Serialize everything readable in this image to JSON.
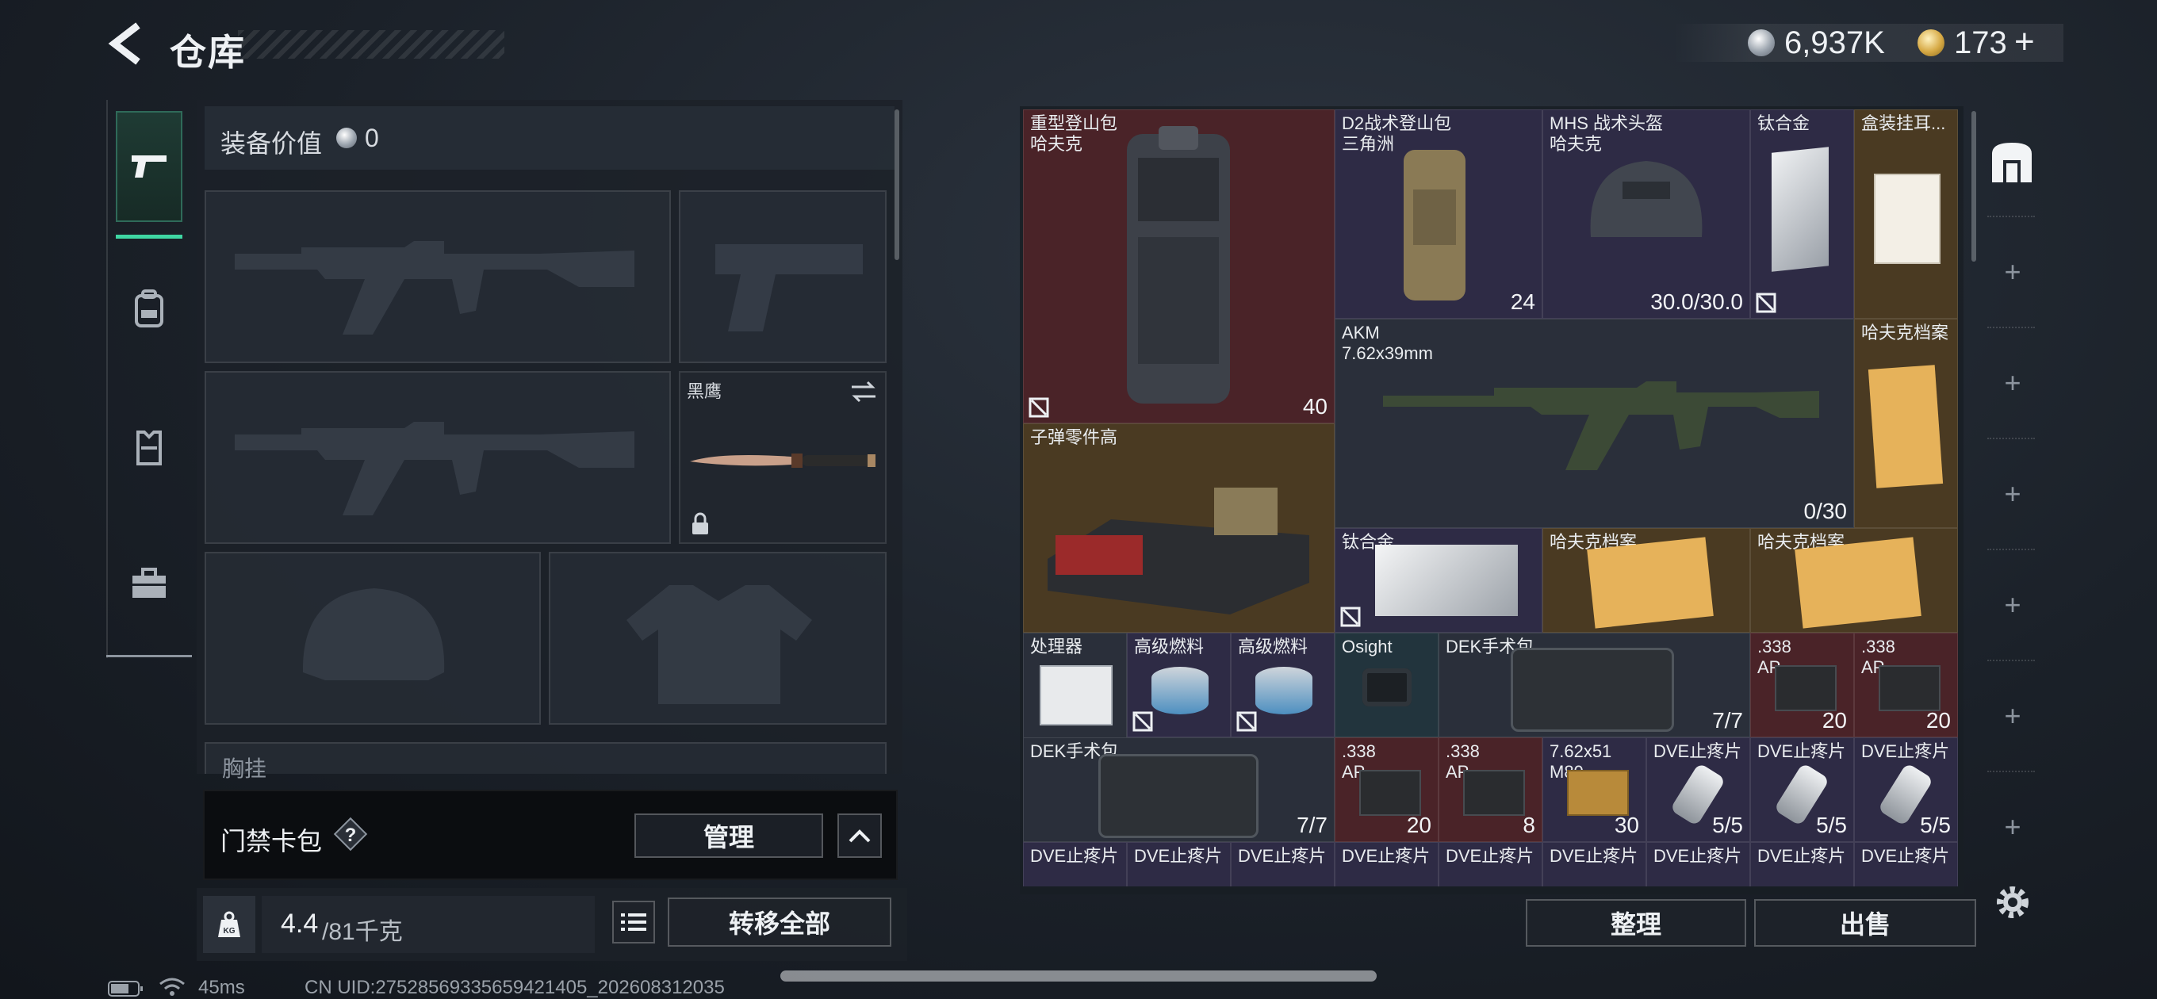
{
  "header": {
    "title": "仓库",
    "currency_silver": "6,937K",
    "currency_gold": "173",
    "add_label": "+"
  },
  "equipment": {
    "label": "装备价值",
    "value": "0",
    "slot_knife_name": "黑鹰",
    "section_chest": "胸挂",
    "keycase_label": "门禁卡包",
    "manage_label": "管理",
    "weight_value": "4.4",
    "weight_max": "/81千克",
    "transfer_all_label": "转移全部"
  },
  "stash": {
    "items": [
      {
        "name": "重型登山包\n哈夫克",
        "count": "40"
      },
      {
        "name": "D2战术登山包\n三角洲",
        "count": "24"
      },
      {
        "name": "MHS 战术头盔\n哈夫克",
        "count": "30.0/30.0"
      },
      {
        "name": "钛合金",
        "count": ""
      },
      {
        "name": "盒装挂耳...",
        "count": ""
      },
      {
        "name": "AKM\n7.62x39mm",
        "count": "0/30"
      },
      {
        "name": "哈夫克档案",
        "count": ""
      },
      {
        "name": "子弹零件高",
        "count": ""
      },
      {
        "name": "钛合金",
        "count": ""
      },
      {
        "name": "哈夫克档案",
        "count": ""
      },
      {
        "name": "哈夫克档案",
        "count": ""
      },
      {
        "name": "处理器",
        "count": ""
      },
      {
        "name": "高级燃料",
        "count": ""
      },
      {
        "name": "高级燃料",
        "count": ""
      },
      {
        "name": "Osight",
        "count": ""
      },
      {
        "name": "DEK手术包",
        "count": "7/7"
      },
      {
        "name": ".338\nAP",
        "count": "20"
      },
      {
        "name": ".338\nAP",
        "count": "20"
      },
      {
        "name": "DEK手术包",
        "count": "7/7"
      },
      {
        "name": ".338\nAP",
        "count": "20"
      },
      {
        "name": ".338\nAP",
        "count": "8"
      },
      {
        "name": "7.62x51\nM80",
        "count": "30"
      },
      {
        "name": "DVE止疼片",
        "count": "5/5"
      },
      {
        "name": "DVE止疼片",
        "count": "5/5"
      },
      {
        "name": "DVE止疼片",
        "count": "5/5"
      },
      {
        "name": "DVE止疼片",
        "count": ""
      },
      {
        "name": "DVE止疼片",
        "count": ""
      },
      {
        "name": "DVE止疼片",
        "count": ""
      },
      {
        "name": "DVE止疼片",
        "count": ""
      },
      {
        "name": "DVE止疼片",
        "count": ""
      },
      {
        "name": "DVE止疼片",
        "count": ""
      },
      {
        "name": "DVE止疼片",
        "count": ""
      },
      {
        "name": "DVE止疼片",
        "count": ""
      },
      {
        "name": "DVE止疼片",
        "count": ""
      }
    ],
    "sort_label": "整理",
    "sell_label": "出售"
  },
  "status": {
    "ping": "45ms",
    "uid": "CN UID:27528569335659421405_202608312035"
  },
  "colors": {
    "accent": "#3fd6a3",
    "red_rarity": "#4a2328",
    "purple_rarity": "#2e2b45",
    "gold_rarity": "#4a3a22"
  },
  "icons": [
    "back-arrow-icon",
    "pistol-icon",
    "backpack-icon",
    "vest-icon",
    "toolbox-icon",
    "silver-coin-icon",
    "gold-coin-icon",
    "help-icon",
    "chevron-up-icon",
    "weight-icon",
    "list-icon",
    "lock-icon",
    "swap-icon",
    "no-trade-icon",
    "stash-icon",
    "settings-icon",
    "battery-icon",
    "wifi-icon"
  ]
}
